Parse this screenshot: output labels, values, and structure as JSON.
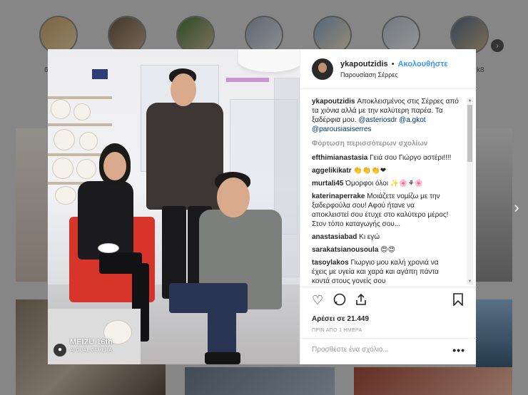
{
  "background": {
    "story_label_left": "6",
    "story_label_right": "k8"
  },
  "post": {
    "username": "ykapoutzidis",
    "separator": "•",
    "follow_label": "Ακολουθήστε",
    "location": "Παρουσίαση Σέρρες",
    "camera_watermark": "MEIZU 16th",
    "camera_watermark_sub": "AI DUAL CAMERA",
    "caption": {
      "username": "ykapoutzidis",
      "text": "Αποκλεισμένος στις Σέρρες από τα χιόνια αλλά με την καλύτερη παρέα. Τα ξαδέρφια μου.",
      "mentions": [
        "@asteriosdr",
        "@a.gkot",
        "@parousiasiserres"
      ]
    },
    "load_more_label": "Φόρτωση περισσότερων σχολίων",
    "comments": [
      {
        "user": "efthimianastasia",
        "text": "Γειά σου Γιώργο αστέρι!!!!"
      },
      {
        "user": "aggelikikatr",
        "text": "👏👏👏❤"
      },
      {
        "user": "murtali45",
        "text": "Όμορφοι όλοι ✨🌸⚘🌸"
      },
      {
        "user": "katerinaperrake",
        "text": "Μοιάζετε νομίζω με την ξαδερφούλα σου! Αφού ήτανε να αποκλειστεί σου έτυχε στο καλύτερο μέρος! Στον τόπο καταγωγής σου..."
      },
      {
        "user": "anastasiabad",
        "text": "Κι εγώ"
      },
      {
        "user": "sarakatsianousoula",
        "text": "😍😍"
      },
      {
        "user": "tasoylakos",
        "text": "Γιωργιο μου καλή χρονιά να έχεις με υγεία και χαρά και αγάπη πάντα κοντά στους γονείς σου"
      }
    ],
    "likes": "Αρέσει σε 21.449",
    "timestamp": "ΠΡΙΝ ΑΠΟ 1 ΗΜΕΡΑ",
    "add_comment_placeholder": "Προσθέστε ένα σχόλιο...",
    "more_label": "•••"
  }
}
